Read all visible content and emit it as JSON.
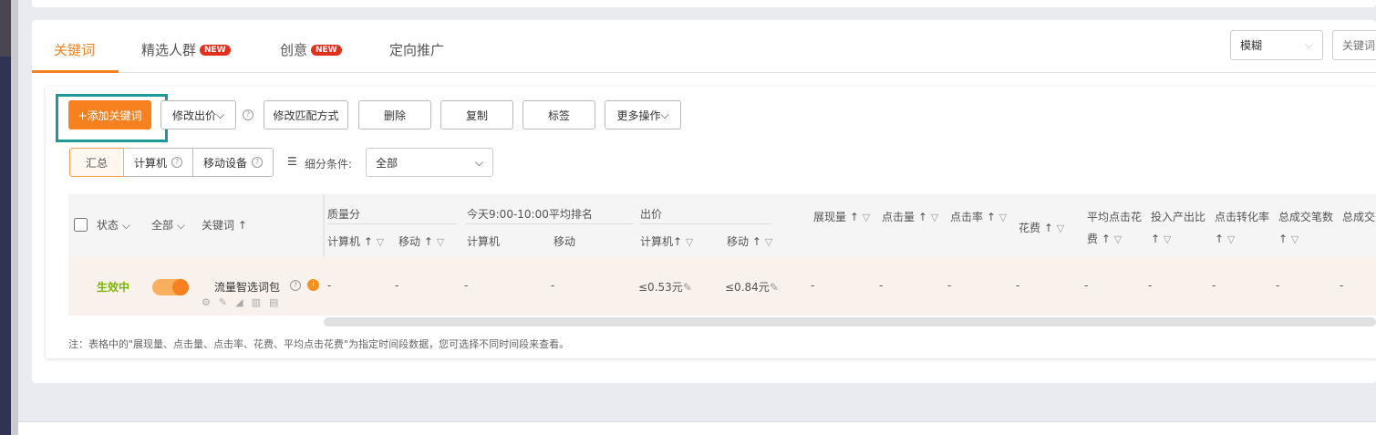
{
  "tabs": [
    {
      "label": "关键词",
      "badge": ""
    },
    {
      "label": "精选人群",
      "badge": "NEW"
    },
    {
      "label": "创意",
      "badge": "NEW"
    },
    {
      "label": "定向推广",
      "badge": ""
    }
  ],
  "search": {
    "mode": "模糊",
    "placeholder": "关键词"
  },
  "toolbar": {
    "add": "+添加关键词",
    "edit_bid": "修改出价",
    "edit_match": "修改匹配方式",
    "delete": "删除",
    "copy": "复制",
    "tag": "标签",
    "more": "更多操作"
  },
  "segments": {
    "summary": "汇总",
    "pc": "计算机",
    "mobile": "移动设备",
    "filter_label": "细分条件:",
    "filter_value": "全部"
  },
  "table": {
    "status_header": "状态",
    "all_header": "全部",
    "keyword_header": "关键词",
    "groups": {
      "quality": "质量分",
      "rank": "今天9:00-10:00平均排名",
      "bid": "出价"
    },
    "sub": {
      "pc": "计算机",
      "mobile": "移动"
    },
    "columns": [
      "展现量",
      "点击量",
      "点击率",
      "花费",
      "平均点击花费",
      "投入产出比",
      "点击转化率",
      "总成交笔数",
      "总成交"
    ],
    "row": {
      "status": "生效中",
      "keyword": "流量智选词包",
      "quality_pc": "-",
      "quality_mobile": "-",
      "rank_pc": "-",
      "rank_mobile": "-",
      "bid_pc": "≤0.53元",
      "bid_mobile": "≤0.84元",
      "metrics": [
        "-",
        "-",
        "-",
        "-",
        "-",
        "-",
        "-",
        "-",
        "-"
      ]
    }
  },
  "note": "注：表格中的\"展现量、点击量、点击率、花费、平均点击花费\"为指定时间段数据，您可选择不同时间段来查看。",
  "colors": {
    "accent": "#f7801f",
    "status_active": "#7cb305",
    "highlight": "#1a9a9a"
  }
}
